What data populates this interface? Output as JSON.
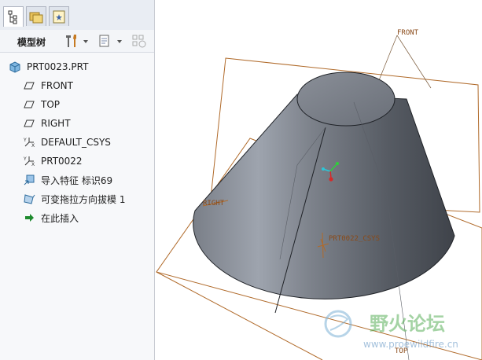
{
  "model_tree": {
    "label": "模型树",
    "items": [
      {
        "label": "PRT0023.PRT",
        "icon": "part-icon"
      },
      {
        "label": "FRONT",
        "icon": "datum-plane-icon"
      },
      {
        "label": "TOP",
        "icon": "datum-plane-icon"
      },
      {
        "label": "RIGHT",
        "icon": "datum-plane-icon"
      },
      {
        "label": "DEFAULT_CSYS",
        "icon": "csys-icon"
      },
      {
        "label": "PRT0022",
        "icon": "csys-icon"
      },
      {
        "label": "导入特征 标识69",
        "icon": "import-feature-icon"
      },
      {
        "label": "可变拖拉方向拔模 1",
        "icon": "draft-feature-icon"
      },
      {
        "label": "在此插入",
        "icon": "insert-here-arrow-icon"
      }
    ]
  },
  "viewport": {
    "datum_labels": {
      "front": "FRONT",
      "right": "RIGHT",
      "top": "TOP",
      "csys": "PRT0022_CSYS"
    }
  },
  "watermark": {
    "title": "野火论坛",
    "url": "www.proewildfire.cn"
  },
  "colors": {
    "datum_line": "#b06a2a",
    "cone_dark": "#4c515a",
    "cone_light": "#9da3ad",
    "panel_bg": "#f7f8fa"
  }
}
